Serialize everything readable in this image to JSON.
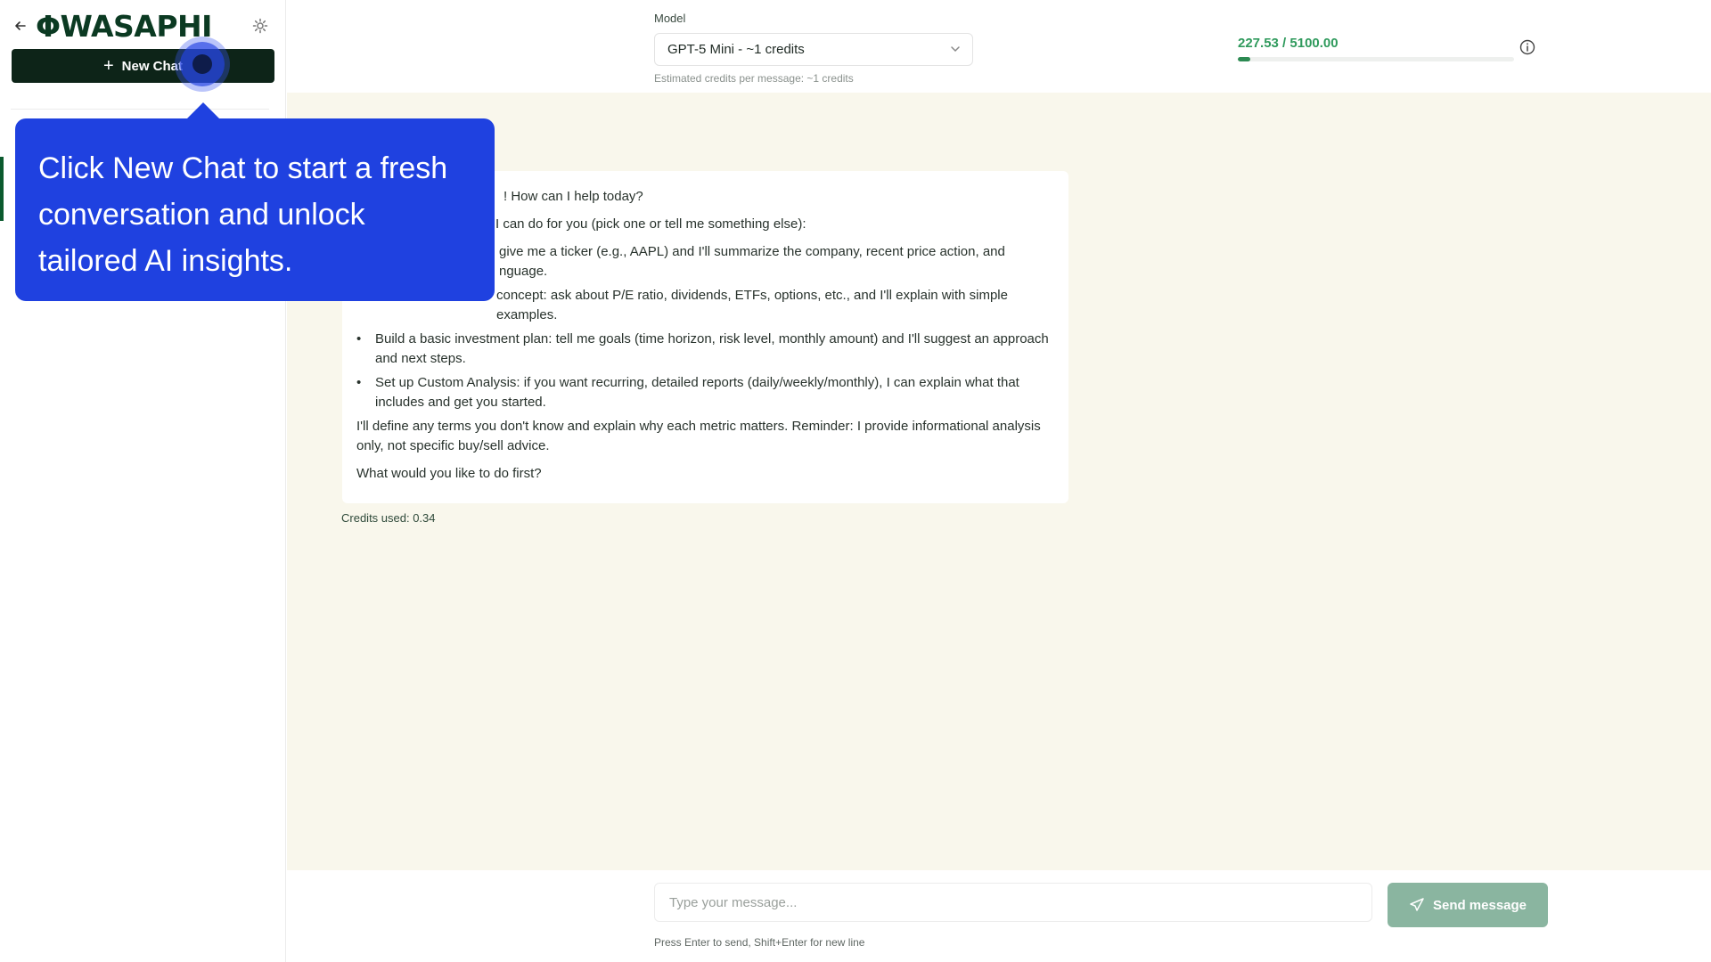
{
  "app": {
    "brand": "ΦWASAPHI"
  },
  "sidebar": {
    "new_chat_label": "New Chat"
  },
  "tooltip": {
    "text": "Click New Chat to start a fresh conversation and unlock tailored AI insights."
  },
  "header": {
    "model_label": "Model",
    "model_selected": "GPT-5 Mini - ~1 credits",
    "model_hint": "Estimated credits per message: ~1 credits",
    "credits_display": "227.53 / 5100.00",
    "credits_used_fraction": 0.0446
  },
  "chat": {
    "assistant_message": {
      "greeting": "! How can I help today?",
      "intro": "I can do for you (pick one or tell me something else):",
      "bullets": [
        "give me a ticker (e.g., AAPL) and I'll summarize the company, recent price action, and nguage.",
        "concept: ask about P/E ratio, dividends, ETFs, options, etc., and I'll explain with simple examples.",
        "Build a basic investment plan: tell me goals (time horizon, risk level, monthly amount) and I'll suggest an approach and next steps.",
        "Set up Custom Analysis: if you want recurring, detailed reports (daily/weekly/monthly), I can explain what that includes and get you started."
      ],
      "note": "I'll define any terms you don't know and explain why each metric matters. Reminder: I provide informational analysis only, not specific buy/sell advice.",
      "question": "What would you like to do first?"
    },
    "credits_used": "Credits used: 0.34"
  },
  "composer": {
    "placeholder": "Type your message...",
    "send_label": "Send message",
    "hint": "Press Enter to send, Shift+Enter for new line"
  },
  "colors": {
    "brand_dark": "#0d2418",
    "accent_green": "#2f9a5c",
    "tooltip_blue": "#1f41e0",
    "chat_bg": "#f9f7ec",
    "send_disabled": "#8ab5a0"
  },
  "icons": [
    "arrow-left-icon",
    "gear-icon",
    "plus-icon",
    "chevron-down-icon",
    "info-icon",
    "send-icon"
  ]
}
